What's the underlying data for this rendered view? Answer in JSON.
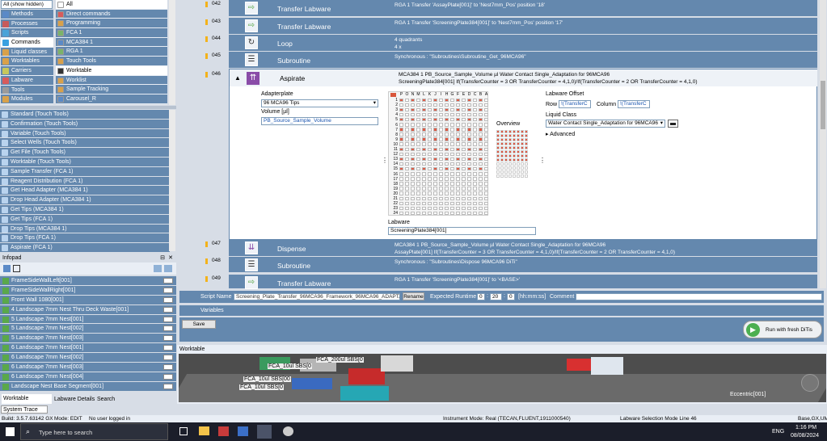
{
  "left_panel": {
    "filter_select": "All (show hidden)",
    "categories": [
      {
        "label": "Methods",
        "color": "#5b8ac7"
      },
      {
        "label": "Processes",
        "color": "#c75b5b"
      },
      {
        "label": "Scripts",
        "color": "#4aa3d8"
      },
      {
        "label": "Commands",
        "color": "#3aa0e0",
        "selected": true
      },
      {
        "label": "Liquid classes",
        "color": "#d8a14a"
      },
      {
        "label": "Worktables",
        "color": "#d8a14a"
      },
      {
        "label": "Carriers",
        "color": "#c7c75b"
      },
      {
        "label": "Labware",
        "color": "#d85b5b"
      },
      {
        "label": "Tools",
        "color": "#9b9b9b"
      },
      {
        "label": "Modules",
        "color": "#d8a14a"
      }
    ],
    "subcategories": [
      {
        "label": "All",
        "color": "#ffffff",
        "selected": true
      },
      {
        "label": "Direct commands",
        "color": "#d85b5b"
      },
      {
        "label": "Programming",
        "color": "#d8a14a"
      },
      {
        "label": "FCA 1",
        "color": "#7ab36a"
      },
      {
        "label": "MCA384 1",
        "color": "#5b8ac7"
      },
      {
        "label": "RGA 1",
        "color": "#7ab36a"
      },
      {
        "label": "Touch Tools",
        "color": "#d8a14a"
      },
      {
        "label": "Worktable",
        "color": "#333333",
        "selected": true
      },
      {
        "label": "Worklist",
        "color": "#d8a14a"
      },
      {
        "label": "Sample Tracking",
        "color": "#d8a14a"
      },
      {
        "label": "Carousel_R",
        "color": "#5b8ac7"
      }
    ],
    "tools": [
      "Standard (Touch Tools)",
      "Confirmation (Touch Tools)",
      "Variable (Touch Tools)",
      "Select Wells (Touch Tools)",
      "Get File (Touch Tools)",
      "Worktable (Touch Tools)",
      "Sample Transfer (FCA 1)",
      "Reagent Distribution (FCA 1)",
      "Get Head Adapter (MCA384 1)",
      "Drop Head Adapter (MCA384 1)",
      "Get Tips (MCA384 1)",
      "Get Tips (FCA 1)",
      "Drop Tips (MCA384 1)",
      "Drop Tips (FCA 1)",
      "Aspirate (FCA 1)"
    ],
    "infopad_title": "Infopad",
    "infopad_items": [
      "FrameSideWallLeft[001]",
      "FrameSideWallRight[001]",
      "Front Wall 1080[001]",
      "4 Landscape 7mm Nest Thru Deck Waste[001]",
      "5 Landscape 7mm Nest[001]",
      "5 Landscape 7mm Nest[002]",
      "5 Landscape 7mm Nest[003]",
      "6 Landscape 7mm Nest[001]",
      "6 Landscape 7mm Nest[002]",
      "6 Landscape 7mm Nest[003]",
      "6 Landscape 7mm Nest[004]",
      "Landscape Nest Base Segment[001]"
    ],
    "bottom_tabs": [
      "Worktable Overview",
      "Labware Details",
      "Search"
    ],
    "system_trace_tab": "System Trace View"
  },
  "script": {
    "steps": [
      {
        "num": "042",
        "title": "Transfer Labware",
        "info1": "RGA 1      Transfer 'AssayPlate[001]' to 'Nest7mm_Pos' position '18'",
        "info2": ""
      },
      {
        "num": "043",
        "title": "Transfer Labware",
        "info1": "RGA 1      Transfer 'ScreeningPlate384[001]' to 'Nest7mm_Pos' position '17'",
        "info2": ""
      },
      {
        "num": "044",
        "title": "Loop",
        "info1": "4 quadrants",
        "info2": "4 x"
      },
      {
        "num": "045",
        "title": "Subroutine",
        "info1": "Synchronous : \"Subroutines\\Subroutine_Get_96MCA96\"",
        "info2": ""
      }
    ],
    "aspirate": {
      "num": "046",
      "title": "Aspirate",
      "info1": "MCA384 1     PB_Source_Sample_Volume µl     Water Contact Single_Adaptation for 96MCA96",
      "info2": "ScreeningPlate384[001]          If(TransferCounter = 3 OR TransferCounter = 4,1,0)/If(TransferCounter = 2 OR TransferCounter = 4,1,0)",
      "adapterplate_label": "Adapterplate",
      "adapterplate_value": "96 MCA96 Tips",
      "volume_label": "Volume [µl]",
      "volume_value": "PB_Source_Sample_Volume",
      "labware_label": "Labware",
      "labware_value": "ScreeningPlate384[001]",
      "overview_label": "Overview",
      "plate_columns": [
        "P",
        "O",
        "N",
        "M",
        "L",
        "K",
        "J",
        "I",
        "H",
        "G",
        "F",
        "E",
        "D",
        "C",
        "B",
        "A"
      ],
      "plate_rows": [
        "1",
        "2",
        "3",
        "4",
        "5",
        "6",
        "7",
        "8",
        "9",
        "10",
        "11",
        "12",
        "13",
        "14",
        "15",
        "16",
        "17",
        "18",
        "19",
        "20",
        "21",
        "22",
        "23",
        "24"
      ],
      "labware_offset_label": "Labware Offset",
      "row_label": "Row",
      "row_value": "!(TransferC",
      "column_label": "Column",
      "column_value": "!(TransferC",
      "liquid_class_label": "Liquid Class",
      "liquid_class_value": "Water Contact Single_Adaptation for 96MCA96",
      "advanced_label": "Advanced"
    },
    "steps_after": [
      {
        "num": "047",
        "title": "Dispense",
        "info1": "MCA384 1     PB_Source_Sample_Volume µl     Water Contact Single_Adaptation for 96MCA96",
        "info2": "AssayPlate[001]          If(TransferCounter = 3 OR TransferCounter = 4,1,0)/If(TransferCounter = 2 OR TransferCounter = 4,1,0)"
      },
      {
        "num": "048",
        "title": "Subroutine",
        "info1": "Synchronous : \"Subroutines\\Dispose 96MCA96 DiTi\"",
        "info2": ""
      },
      {
        "num": "049",
        "title": "Transfer Labware",
        "info1": "RGA 1      Transfer 'ScreeningPlate384[001]' to '<BASE>'",
        "info2": ""
      }
    ]
  },
  "script_bar": {
    "script_name_label": "Script Name",
    "script_name_value": "Screening_Plate_Transfer_96MCA96_Framework_96MCA96_ADAPTA",
    "rename_label": "Rename",
    "runtime_label": "Expected Runtime",
    "runtime_h": "0",
    "runtime_m": "20",
    "runtime_s": "0",
    "runtime_unit": "[hh:mm:ss]",
    "comment_label": "Comment",
    "variables_label": "Variables",
    "save_label": "Save",
    "run_label": "Run with fresh DiTis"
  },
  "worktable": {
    "title": "Worktable",
    "labels": [
      "FCA_10ul SBS[00",
      "FCA_200ul SBS[0",
      "FCA_10ul SBS[0",
      "FCA_10ul SBS[0",
      "Eccentric[001]"
    ]
  },
  "status_bar": {
    "build": "Build: 3.5.7.63142 GX",
    "mode": "Mode: EDIT",
    "user": "No user logged in",
    "instrument": "Instrument Mode: Real (TECAN,FLUENT,1911000540)",
    "labware_sel": "Labware Selection Mode Line 46",
    "right": "Base,GX,UM"
  },
  "taskbar": {
    "search_placeholder": "Type here to search",
    "lang": "ENG",
    "time": "1:16 PM",
    "date": "08/08/2024"
  }
}
